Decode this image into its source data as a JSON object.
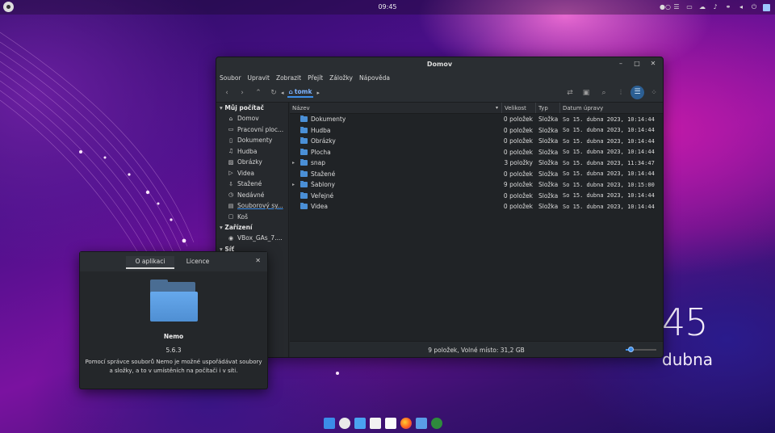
{
  "panel": {
    "clock": "09:45"
  },
  "desktop": {
    "time": "45",
    "date": "dubna"
  },
  "window": {
    "title": "Domov",
    "menu": [
      "Soubor",
      "Upravit",
      "Zobrazit",
      "Přejít",
      "Záložky",
      "Nápověda"
    ],
    "path": "tomk",
    "sidebar": {
      "sections": [
        {
          "title": "Můj počítač",
          "items": [
            "Domov",
            "Pracovní ploc...",
            "Dokumenty",
            "Hudba",
            "Obrázky",
            "Videa",
            "Stažené",
            "Nedávné",
            "Souborový sy...",
            "Koš"
          ]
        },
        {
          "title": "Zařízení",
          "items": [
            "VBox_GAs_7...."
          ]
        },
        {
          "title": "Síť",
          "items": []
        }
      ]
    },
    "columns": {
      "name": "Název",
      "size": "Velikost",
      "type": "Typ",
      "date": "Datum úpravy"
    },
    "files": [
      {
        "name": "Dokumenty",
        "size": "0 položek",
        "type": "Složka",
        "date": "So 15. dubna 2023, 10:14:44",
        "expandable": false
      },
      {
        "name": "Hudba",
        "size": "0 položek",
        "type": "Složka",
        "date": "So 15. dubna 2023, 10:14:44",
        "expandable": false
      },
      {
        "name": "Obrázky",
        "size": "0 položek",
        "type": "Složka",
        "date": "So 15. dubna 2023, 10:14:44",
        "expandable": false
      },
      {
        "name": "Plocha",
        "size": "0 položek",
        "type": "Složka",
        "date": "So 15. dubna 2023, 10:14:44",
        "expandable": false
      },
      {
        "name": "snap",
        "size": "3 položky",
        "type": "Složka",
        "date": "So 15. dubna 2023, 11:34:47",
        "expandable": true
      },
      {
        "name": "Stažené",
        "size": "0 položek",
        "type": "Složka",
        "date": "So 15. dubna 2023, 10:14:44",
        "expandable": false
      },
      {
        "name": "Šablony",
        "size": "9 položek",
        "type": "Složka",
        "date": "So 15. dubna 2023, 10:15:00",
        "expandable": true
      },
      {
        "name": "Veřejné",
        "size": "0 položek",
        "type": "Složka",
        "date": "So 15. dubna 2023, 10:14:44",
        "expandable": false
      },
      {
        "name": "Videa",
        "size": "0 položek",
        "type": "Složka",
        "date": "So 15. dubna 2023, 10:14:44",
        "expandable": false
      }
    ],
    "status": "9 položek, Volné místo: 31,2 GB",
    "zoom_level": 0.15
  },
  "about": {
    "tabs": [
      "O aplikaci",
      "Licence"
    ],
    "app_name": "Nemo",
    "version": "5.6.3",
    "description": "Pomocí správce souborů Nemo je možné uspořádávat soubory a složky, a to v umístěních na počítači i v síti."
  },
  "colors": {
    "accent": "#3d8ee8",
    "folder": "#4a8fd6"
  },
  "dock_icons": [
    "apps-icon",
    "settings-icon",
    "store-icon",
    "files-icon",
    "text-editor-icon",
    "firefox-icon",
    "folder-icon",
    "terminal-icon"
  ]
}
